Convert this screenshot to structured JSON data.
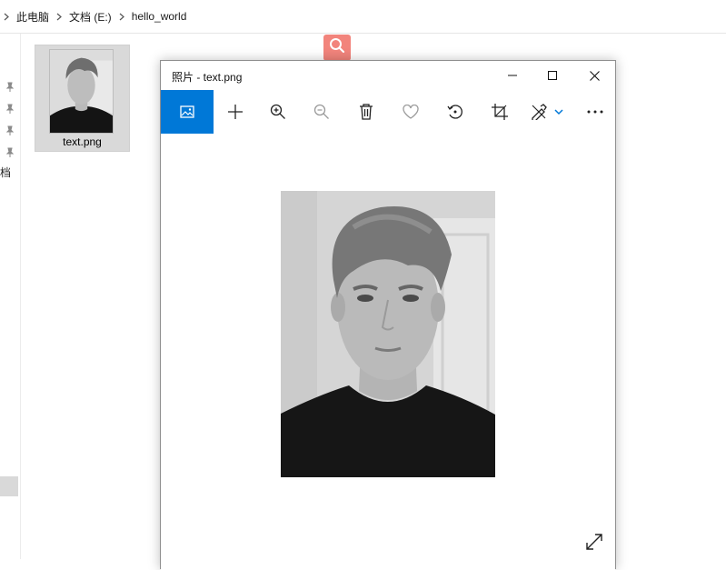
{
  "explorer": {
    "breadcrumb": [
      {
        "label": "此电脑"
      },
      {
        "label": "文档 (E:)"
      },
      {
        "label": "hello_world"
      }
    ],
    "nav_partial_text": "档",
    "file": {
      "name": "text.png"
    }
  },
  "photos": {
    "title": "照片 - text.png",
    "toolbar_icons": [
      "image-icon",
      "plus-icon",
      "zoom-in-icon",
      "zoom-out-icon",
      "delete-icon",
      "heart-icon",
      "rotate-icon",
      "crop-icon",
      "edit-icon",
      "more-icon"
    ]
  },
  "colors": {
    "accent": "#0078d7",
    "search_badge": "#f2847c"
  }
}
